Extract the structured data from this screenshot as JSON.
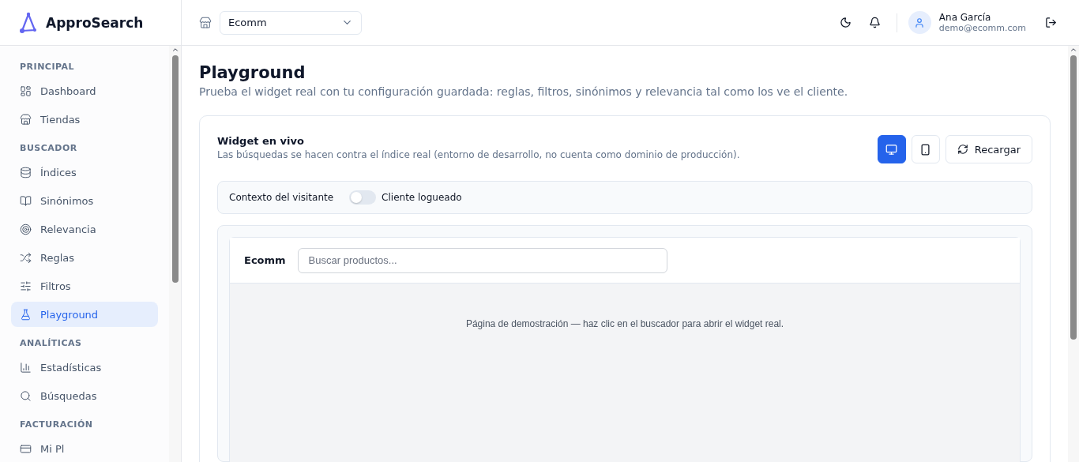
{
  "brand": {
    "name": "ApproSearch"
  },
  "sidebar": {
    "sections": [
      {
        "title": "PRINCIPAL",
        "items": [
          {
            "label": "Dashboard",
            "selected": false
          },
          {
            "label": "Tiendas",
            "selected": false
          }
        ]
      },
      {
        "title": "BUSCADOR",
        "items": [
          {
            "label": "Índices",
            "selected": false
          },
          {
            "label": "Sinónimos",
            "selected": false
          },
          {
            "label": "Relevancia",
            "selected": false
          },
          {
            "label": "Reglas",
            "selected": false
          },
          {
            "label": "Filtros",
            "selected": false
          },
          {
            "label": "Playground",
            "selected": true
          }
        ]
      },
      {
        "title": "ANALÍTICAS",
        "items": [
          {
            "label": "Estadísticas",
            "selected": false
          },
          {
            "label": "Búsquedas",
            "selected": false
          }
        ]
      },
      {
        "title": "FACTURACIÓN",
        "items": [
          {
            "label": "Mi Pl",
            "selected": false
          }
        ]
      }
    ]
  },
  "topbar": {
    "store_select": "Ecomm",
    "user": {
      "name": "Ana García",
      "email": "demo@ecomm.com"
    }
  },
  "page": {
    "title": "Playground",
    "subtitle": "Prueba el widget real con tu configuración guardada: reglas, filtros, sinónimos y relevancia tal como los ve el cliente."
  },
  "widget_card": {
    "title": "Widget en vivo",
    "description": "Las búsquedas se hacen contra el índice real (entorno de desarrollo, no cuenta como dominio de producción).",
    "devices": [
      {
        "kind": "desktop",
        "selected": true
      },
      {
        "kind": "mobile",
        "selected": false
      }
    ],
    "reload_button": "Recargar",
    "context": {
      "label": "Contexto del visitante",
      "toggle_label": "Cliente logueado",
      "on": false
    },
    "preview": {
      "store_name": "Ecomm",
      "search_placeholder": "Buscar productos...",
      "demo_text": "Página de demostración — haz clic en el buscador para abrir el widget real."
    }
  }
}
